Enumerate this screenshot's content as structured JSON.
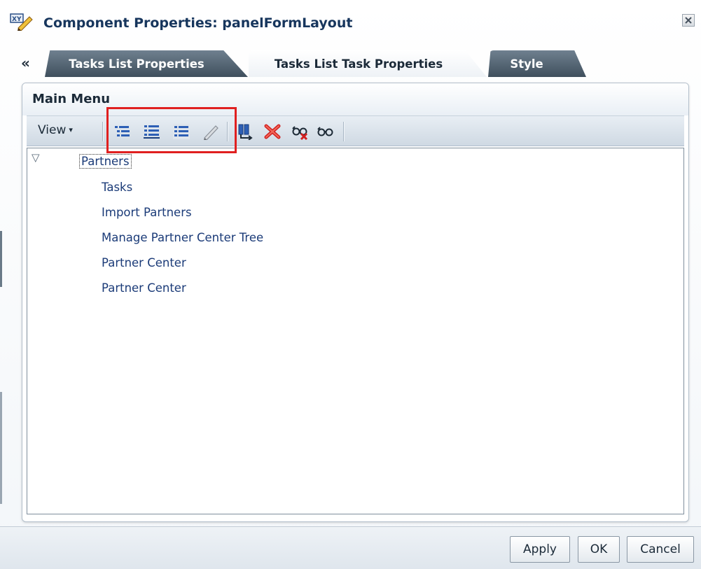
{
  "dialog": {
    "title": "Component Properties: panelFormLayout",
    "title_icon": "xy-component-icon",
    "close_icon": "close-icon"
  },
  "tabs": {
    "collapse_label": "«",
    "items": [
      {
        "label": "Tasks List Properties",
        "active": false
      },
      {
        "label": "Tasks List Task Properties",
        "active": true
      },
      {
        "label": "Style",
        "active": false
      }
    ]
  },
  "panel": {
    "title": "Main Menu",
    "toolbar": {
      "view_label": "View",
      "view_caret": "▾",
      "icons": [
        "insert-child-icon",
        "insert-above-icon",
        "insert-below-icon",
        "edit-pencil-icon",
        "duplicate-icon",
        "delete-icon",
        "hide-icon",
        "show-icon"
      ],
      "highlight_color": "#e02020"
    },
    "tree": {
      "expand_glyph": "▽",
      "root": "Partners",
      "children": [
        "Tasks",
        "Import Partners",
        "Manage Partner Center Tree",
        "Partner Center",
        "Partner Center"
      ]
    }
  },
  "footer": {
    "apply_label": "Apply",
    "ok_label": "OK",
    "cancel_label": "Cancel"
  },
  "colors": {
    "title_text": "#17365d",
    "tree_link": "#1b3b78",
    "tab_inactive": "#4f5f6d"
  }
}
